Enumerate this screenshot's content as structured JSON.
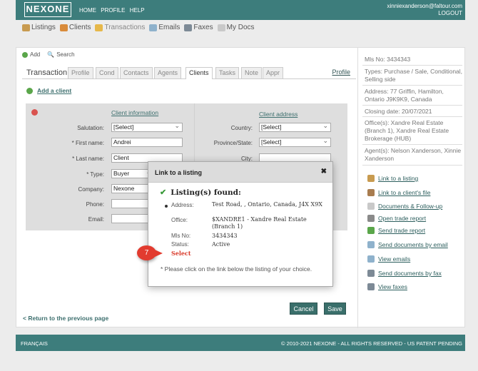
{
  "header": {
    "logo": "NEXONE",
    "nav": [
      "HOME",
      "PROFILE",
      "HELP"
    ],
    "email": "xinniexanderson@faltour.com",
    "logout": "LOGOUT"
  },
  "mainnav": {
    "listings": "Listings",
    "clients": "Clients",
    "transactions": "Transactions",
    "emails": "Emails",
    "faxes": "Faxes",
    "mydocs": "My Docs"
  },
  "actions": {
    "add": "Add",
    "search": "Search"
  },
  "tabs": {
    "title": "Transaction",
    "items": [
      "Profile",
      "Cond",
      "Contacts",
      "Agents",
      "Clients",
      "Tasks",
      "Note",
      "Appr"
    ],
    "profile_link": "Profile"
  },
  "form": {
    "add_client": "Add a client",
    "client_info": "Client information",
    "client_address": "Client address",
    "salutation_label": "Salutation:",
    "salutation_value": "[Select]",
    "first_name_label": "* First name:",
    "first_name_value": "Andrei",
    "last_name_label": "* Last name:",
    "last_name_value": "Client",
    "type_label": "* Type:",
    "type_value": "Buyer",
    "company_label": "Company:",
    "company_value": "Nexone",
    "phone_label": "Phone:",
    "email_label": "Email:",
    "country_label": "Country:",
    "country_value": "[Select]",
    "province_label": "Province/State:",
    "province_value": "[Select]",
    "city_label": "City:"
  },
  "buttons": {
    "cancel": "Cancel",
    "save": "Save"
  },
  "back_link": "< Return to the previous page",
  "summary": {
    "mls": "Mls No:  3434343",
    "types": "Types:  Purchase / Sale, Conditional, Selling side",
    "address": "Address:  77 Griffin, Hamilton, Ontario J9K9K9, Canada",
    "closing": "Closing date:  20/07/2021",
    "offices": "Office(s):  Xandre Real Estate (Branch 1), Xandre Real Estate Brokerage (HUB)",
    "agents": "Agent(s):  Nelson Xanderson, Xinnie Xanderson"
  },
  "side_actions": [
    "Link to a listing",
    "Link to a client's file",
    "Documents & Follow-up",
    "Open trade report",
    "Send trade report",
    "Send documents by email",
    "View emails",
    "Send documents by fax",
    "View faxes"
  ],
  "footer": {
    "lang": "FRANÇAIS",
    "copyright": "© 2010-2021 NEXONE - ALL RIGHTS RESERVED - US PATENT PENDING"
  },
  "modal": {
    "title": "Link to a listing",
    "close": "✖",
    "found": "Listing(s) found:",
    "address_label": "Address:",
    "address_value": "Test Road, , Ontario, Canada, J4X X9X",
    "office_label": "Office:",
    "office_value": "$XANDRE1 - Xandre Real Estate (Branch 1)",
    "mls_label": "Mls No:",
    "mls_value": "3434343",
    "status_label": "Status:",
    "status_value": "Active",
    "select": "Select",
    "note": "* Please click on the link below the listing of your choice."
  },
  "callout": "7"
}
